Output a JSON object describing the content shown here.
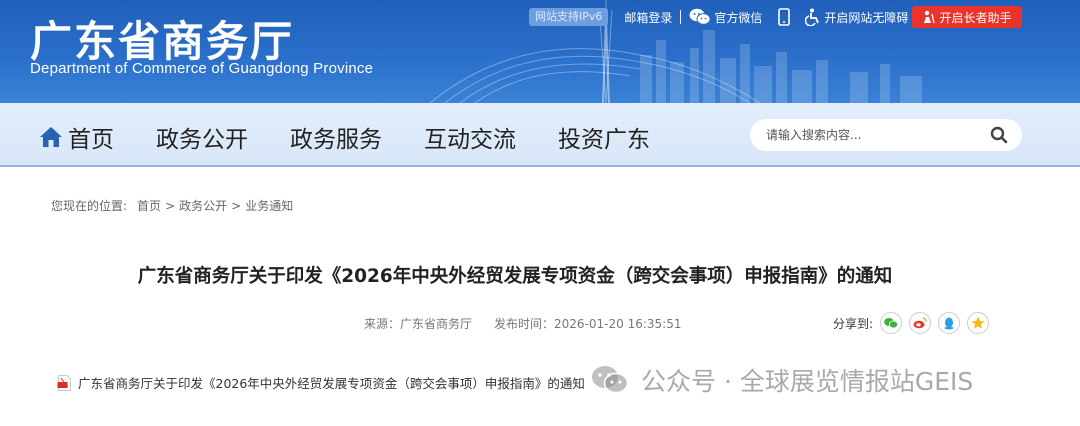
{
  "header": {
    "title": "广东省商务厅",
    "subtitle": "Department of Commerce of Guangdong Province",
    "ipv6_badge": "网站支持IPv6",
    "links": [
      {
        "label": "邮箱登录",
        "icon": "none"
      },
      {
        "label": "官方微信",
        "icon": "wechat-icon"
      },
      {
        "label": "",
        "icon": "mobile-icon"
      },
      {
        "label": "开启网站无障碍",
        "icon": "accessibility-icon"
      }
    ],
    "elder_mode": "开启长者助手",
    "colors": {
      "banner": "#2a6fca",
      "elder_button": "#e8342a"
    }
  },
  "nav": {
    "items": [
      {
        "label": "首页",
        "icon": "home-icon"
      },
      {
        "label": "政务公开"
      },
      {
        "label": "政务服务"
      },
      {
        "label": "互动交流"
      },
      {
        "label": "投资广东"
      }
    ],
    "search_placeholder": "请输入搜索内容..."
  },
  "breadcrumb": {
    "prefix": "您现在的位置:",
    "items": [
      "首页",
      "政务公开",
      "业务通知"
    ],
    "separator": ">"
  },
  "article": {
    "title": "广东省商务厅关于印发《2026年中央外经贸发展专项资金（跨交会事项）申报指南》的通知",
    "source": "来源：广东省商务厅",
    "publish_time": "发布时间：2026-01-20 16:35:51",
    "share_label": "分享到:",
    "share_icons": [
      "wechat-icon",
      "weibo-icon",
      "qq-icon",
      "qzone-icon"
    ],
    "attachment": "广东省商务厅关于印发《2026年中央外经贸发展专项资金（跨交会事项）申报指南》的通知"
  },
  "watermark": {
    "text": "公众号 · 全球展览情报站GEIS"
  }
}
